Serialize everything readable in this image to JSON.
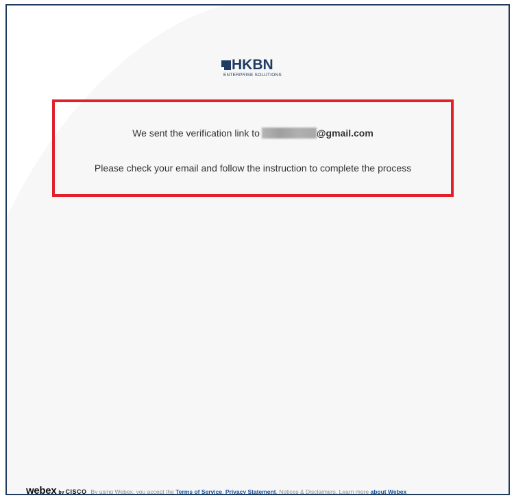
{
  "brand": {
    "name": "HKBN",
    "tagline": "Enterprise Solutions"
  },
  "message": {
    "line1_prefix": "We sent the verification link to",
    "email_domain": "@gmail.com",
    "line2": "Please check your email and follow the instruction to complete the process"
  },
  "footer": {
    "webex": "webex",
    "by": "by",
    "cisco": "CISCO",
    "text_before": "By using Webex, you accept the",
    "terms_link": "Terms of Service",
    "sep1": ",",
    "privacy_link": "Privacy Statement",
    "text_middle": ", Notices & Disclaimers. Learn more",
    "about_link": "about Webex"
  },
  "colors": {
    "highlight_border": "#e0202b",
    "brand_blue": "#1f3b63",
    "link_blue": "#1a52a0"
  }
}
